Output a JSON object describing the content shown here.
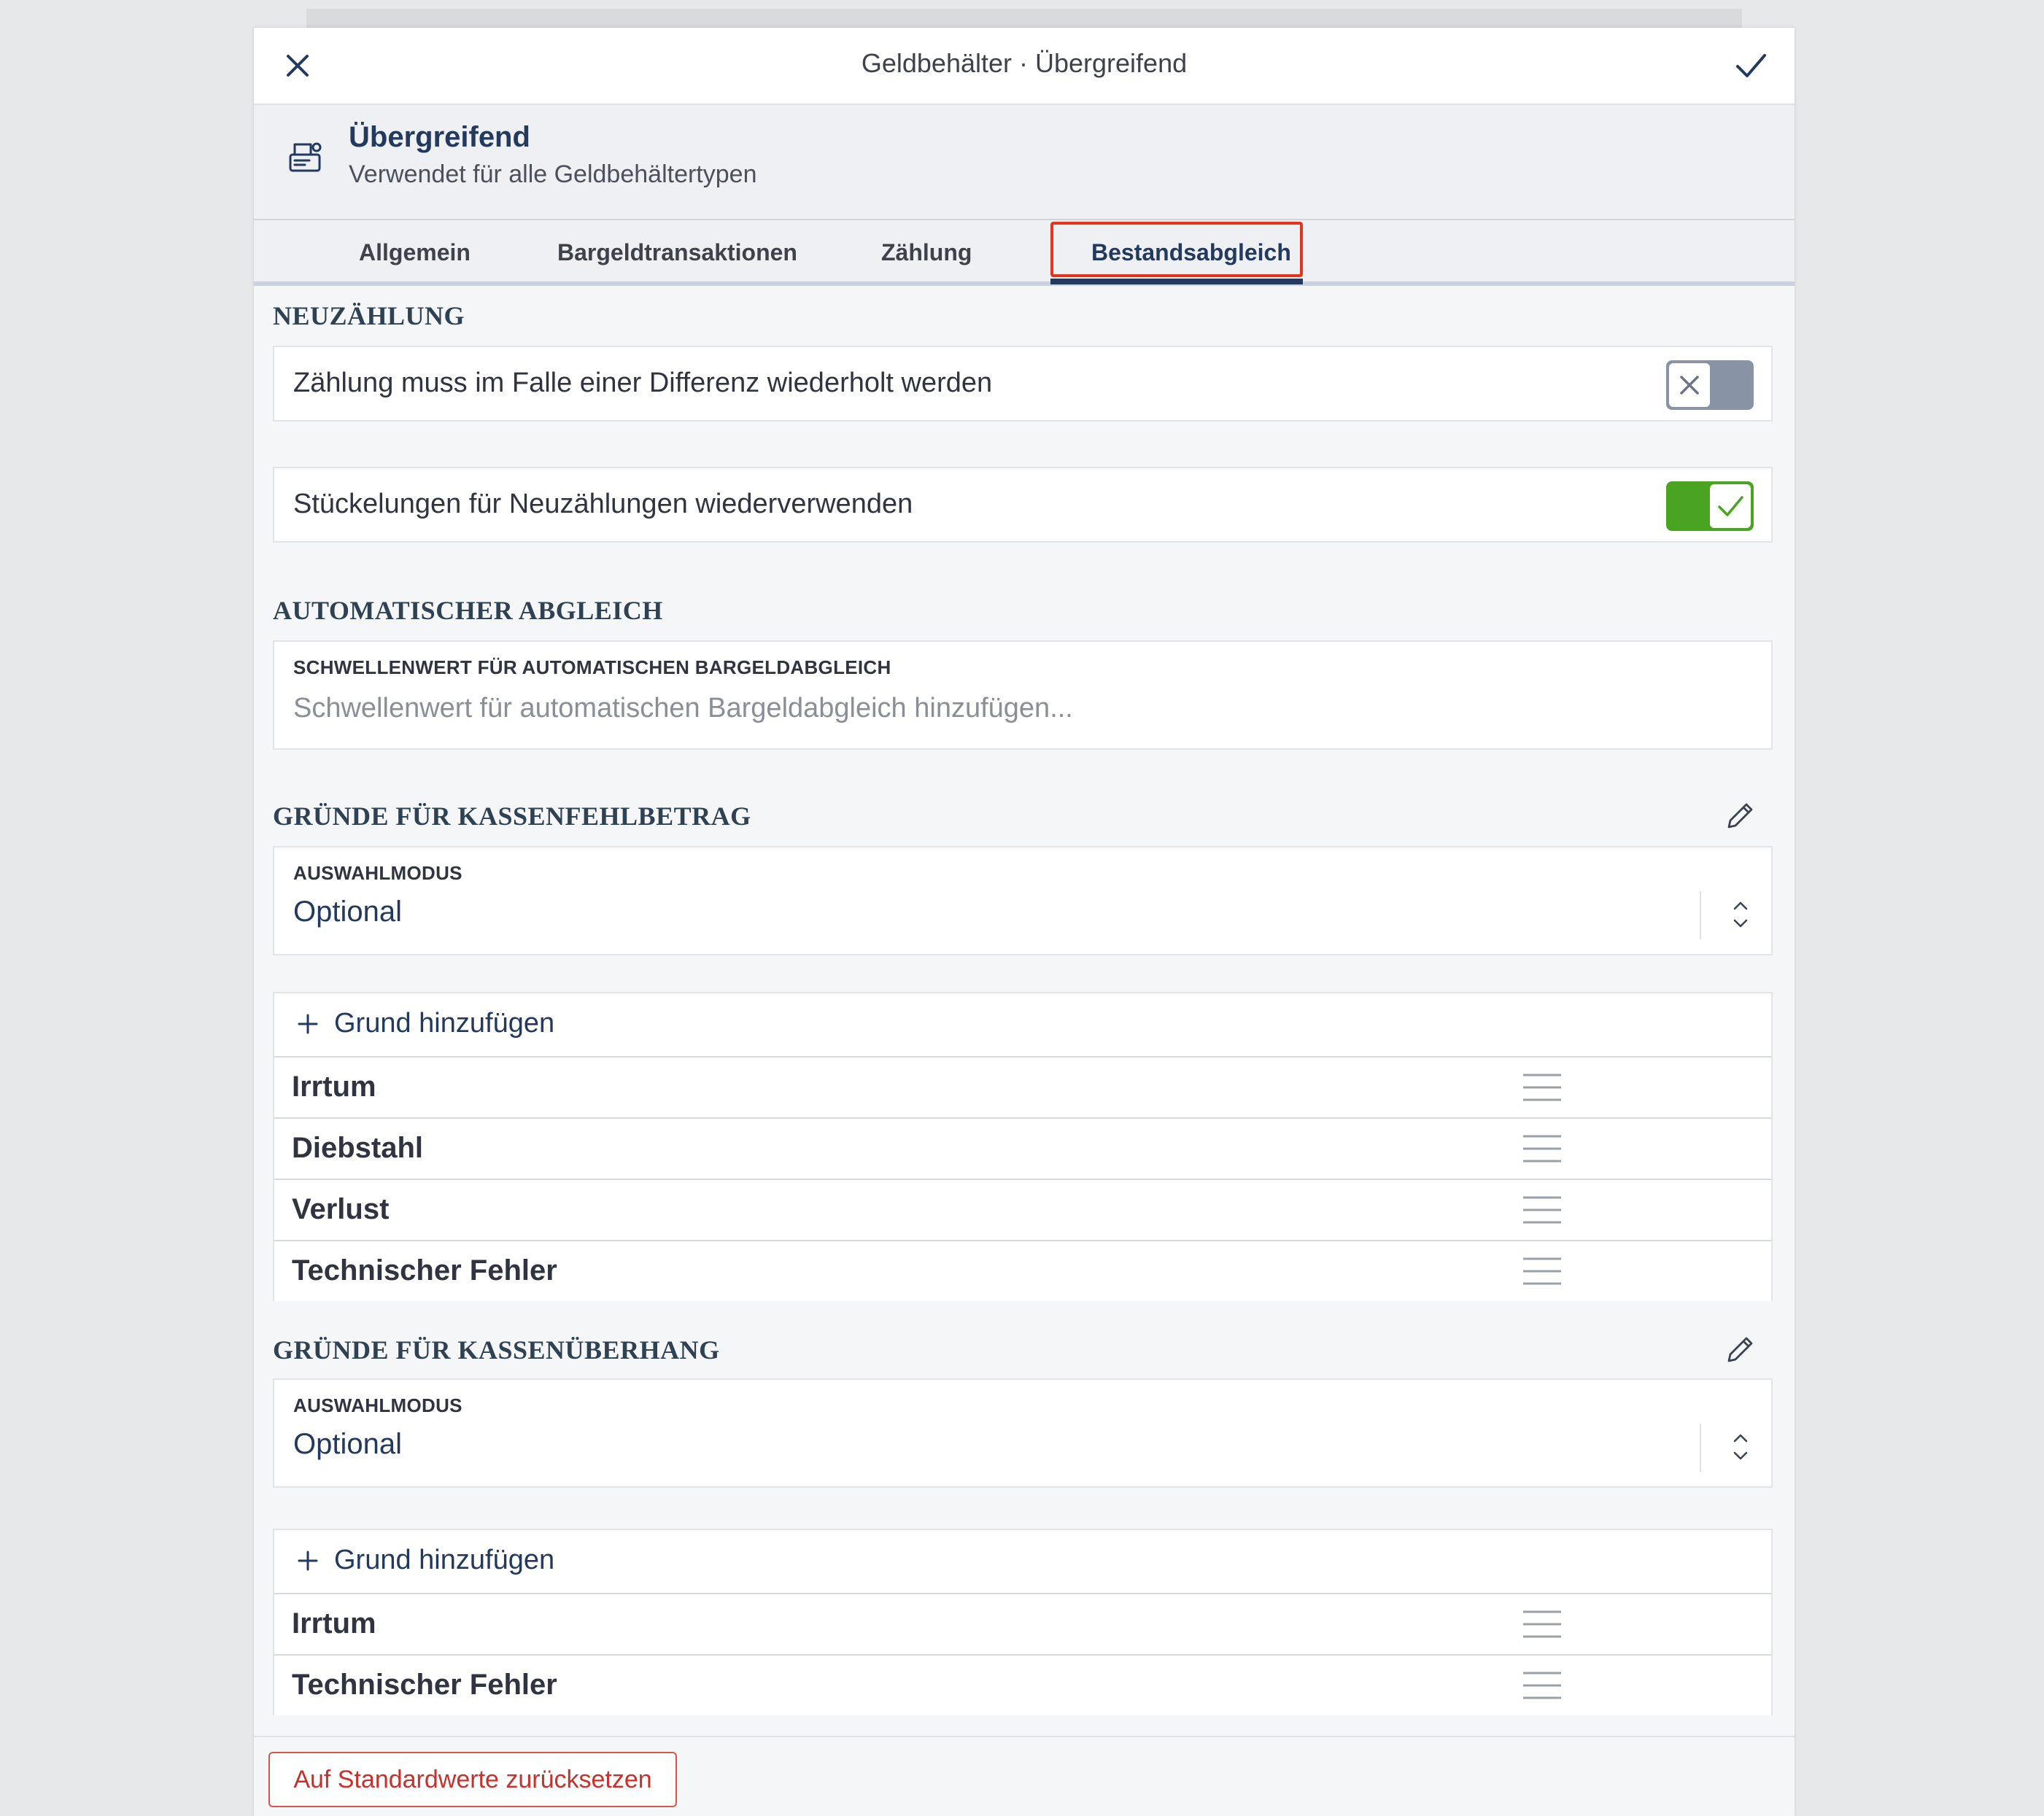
{
  "window": {
    "title": "Geldbehälter · Übergreifend"
  },
  "header": {
    "title": "Übergreifend",
    "subtitle": "Verwendet für alle Geldbehältertypen"
  },
  "tabs": [
    {
      "label": "Allgemein",
      "active": false
    },
    {
      "label": "Bargeldtransaktionen",
      "active": false
    },
    {
      "label": "Zählung",
      "active": false
    },
    {
      "label": "Bestandsabgleich",
      "active": true
    }
  ],
  "neuzaehlung": {
    "title": "NEUZÄHLUNG",
    "repeat_on_difference": {
      "label": "Zählung muss im Falle einer Differenz wiederholt werden",
      "enabled": false
    },
    "reuse_denominations": {
      "label": "Stückelungen für Neuzählungen wiederverwenden",
      "enabled": true
    }
  },
  "auto_abgleich": {
    "title": "AUTOMATISCHER ABGLEICH",
    "threshold_label": "SCHWELLENWERT FÜR AUTOMATISCHEN BARGELDABGLEICH",
    "threshold_placeholder": "Schwellenwert für automatischen Bargeldabgleich hinzufügen..."
  },
  "fehlbetrag": {
    "title": "GRÜNDE FÜR KASSENFEHLBETRAG",
    "mode_label": "AUSWAHLMODUS",
    "mode_value": "Optional",
    "add_label": "Grund hinzufügen",
    "reasons": [
      "Irrtum",
      "Diebstahl",
      "Verlust",
      "Technischer Fehler"
    ]
  },
  "ueberhang": {
    "title": "GRÜNDE FÜR KASSENÜBERHANG",
    "mode_label": "AUSWAHLMODUS",
    "mode_value": "Optional",
    "add_label": "Grund hinzufügen",
    "reasons": [
      "Irrtum",
      "Technischer Fehler"
    ]
  },
  "footer": {
    "reset_label": "Auf Standardwerte zurücksetzen"
  },
  "colors": {
    "accent": "#233a5e",
    "toggle_on": "#4aa321",
    "toggle_off": "#8894a6",
    "highlight": "#e5341c",
    "danger": "#c9302c"
  },
  "icons": [
    "close-icon",
    "checkmark-icon",
    "cash-register-icon",
    "pencil-icon",
    "plus-icon",
    "drag-handle-icon",
    "chevron-updown-icon"
  ]
}
